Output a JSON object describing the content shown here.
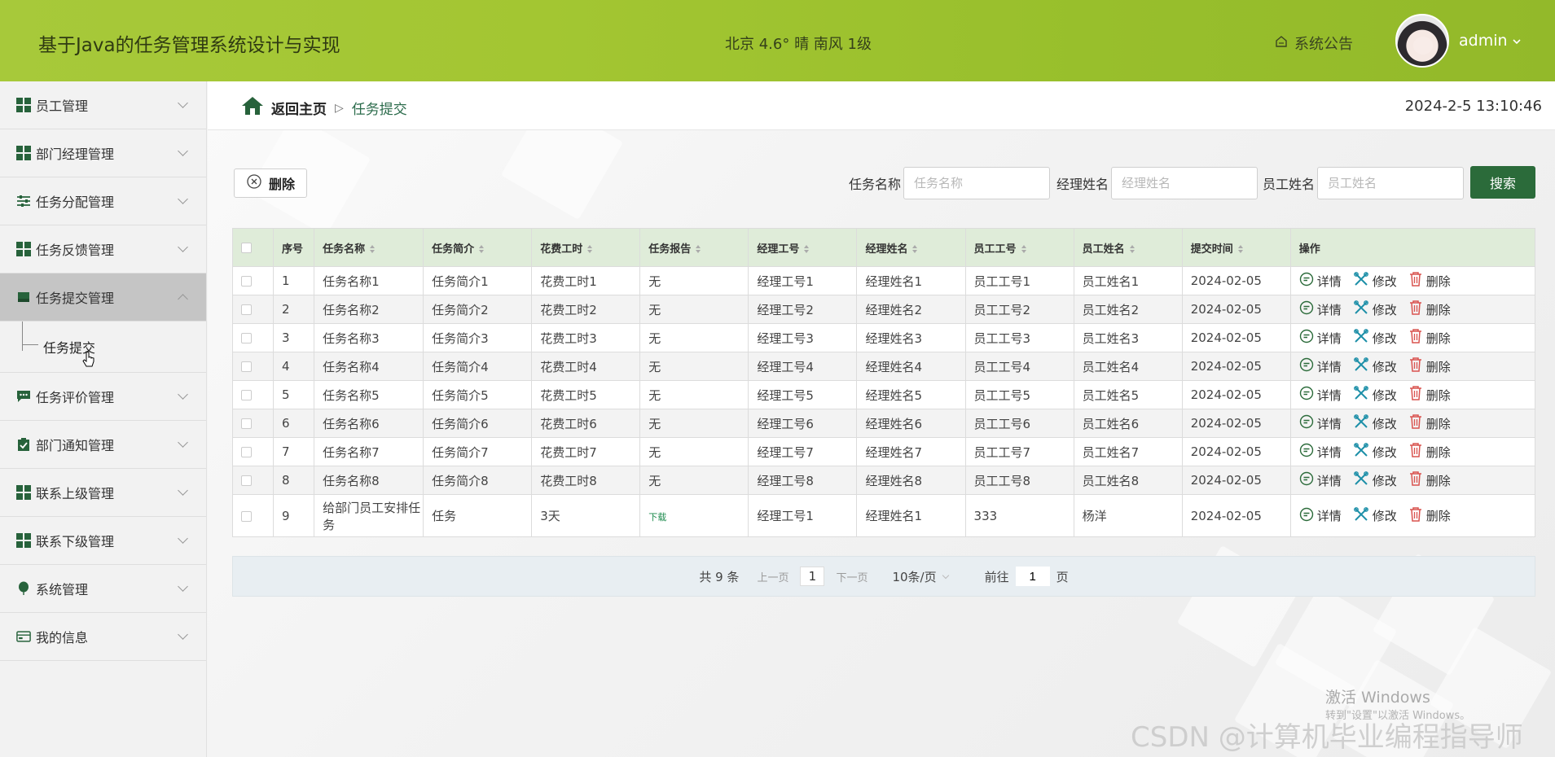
{
  "header": {
    "title": "基于Java的任务管理系统设计与实现",
    "weather": "北京 4.6° 晴 南风 1级",
    "notice": "系统公告",
    "username": "admin"
  },
  "sidebar": {
    "items": [
      {
        "label": "员工管理",
        "icon": "grid-icon"
      },
      {
        "label": "部门经理管理",
        "icon": "grid-icon"
      },
      {
        "label": "任务分配管理",
        "icon": "sliders-icon"
      },
      {
        "label": "任务反馈管理",
        "icon": "grid-icon"
      },
      {
        "label": "任务提交管理",
        "icon": "inbox-icon"
      },
      {
        "label": "任务评价管理",
        "icon": "comment-icon"
      },
      {
        "label": "部门通知管理",
        "icon": "clipboard-check-icon"
      },
      {
        "label": "联系上级管理",
        "icon": "grid-icon"
      },
      {
        "label": "联系下级管理",
        "icon": "grid-icon"
      },
      {
        "label": "系统管理",
        "icon": "balloon-icon"
      },
      {
        "label": "我的信息",
        "icon": "card-icon"
      }
    ],
    "submenu_label": "任务提交"
  },
  "breadcrumb": {
    "home": "返回主页",
    "current": "任务提交"
  },
  "datetime": "2024-2-5 13:10:46",
  "toolbar": {
    "delete_label": "删除",
    "search_label": "搜索"
  },
  "search": {
    "task_name_label": "任务名称",
    "task_name_placeholder": "任务名称",
    "manager_name_label": "经理姓名",
    "manager_name_placeholder": "经理姓名",
    "employee_name_label": "员工姓名",
    "employee_name_placeholder": "员工姓名"
  },
  "table": {
    "headers": [
      "序号",
      "任务名称",
      "任务简介",
      "花费工时",
      "任务报告",
      "经理工号",
      "经理姓名",
      "员工工号",
      "员工姓名",
      "提交时间",
      "操作"
    ],
    "ops": {
      "detail": "详情",
      "edit": "修改",
      "delete": "删除"
    },
    "rows": [
      [
        "1",
        "任务名称1",
        "任务简介1",
        "花费工时1",
        "无",
        "经理工号1",
        "经理姓名1",
        "员工工号1",
        "员工姓名1",
        "2024-02-05"
      ],
      [
        "2",
        "任务名称2",
        "任务简介2",
        "花费工时2",
        "无",
        "经理工号2",
        "经理姓名2",
        "员工工号2",
        "员工姓名2",
        "2024-02-05"
      ],
      [
        "3",
        "任务名称3",
        "任务简介3",
        "花费工时3",
        "无",
        "经理工号3",
        "经理姓名3",
        "员工工号3",
        "员工姓名3",
        "2024-02-05"
      ],
      [
        "4",
        "任务名称4",
        "任务简介4",
        "花费工时4",
        "无",
        "经理工号4",
        "经理姓名4",
        "员工工号4",
        "员工姓名4",
        "2024-02-05"
      ],
      [
        "5",
        "任务名称5",
        "任务简介5",
        "花费工时5",
        "无",
        "经理工号5",
        "经理姓名5",
        "员工工号5",
        "员工姓名5",
        "2024-02-05"
      ],
      [
        "6",
        "任务名称6",
        "任务简介6",
        "花费工时6",
        "无",
        "经理工号6",
        "经理姓名6",
        "员工工号6",
        "员工姓名6",
        "2024-02-05"
      ],
      [
        "7",
        "任务名称7",
        "任务简介7",
        "花费工时7",
        "无",
        "经理工号7",
        "经理姓名7",
        "员工工号7",
        "员工姓名7",
        "2024-02-05"
      ],
      [
        "8",
        "任务名称8",
        "任务简介8",
        "花费工时8",
        "无",
        "经理工号8",
        "经理姓名8",
        "员工工号8",
        "员工姓名8",
        "2024-02-05"
      ],
      [
        "9",
        "给部门员工安排任务",
        "任务",
        "3天",
        "下载",
        "经理工号1",
        "经理姓名1",
        "333",
        "杨洋",
        "2024-02-05"
      ]
    ]
  },
  "pager": {
    "total": "共 9 条",
    "prev": "上一页",
    "page": "1",
    "next": "下一页",
    "page_size": "10条/页",
    "goto_prefix": "前往",
    "goto_value": "1",
    "goto_suffix": "页"
  },
  "watermarks": {
    "windows_title": "激活 Windows",
    "windows_sub": "转到\"设置\"以激活 Windows。",
    "csdn": "CSDN @计算机毕业编程指导师"
  },
  "colors": {
    "header_green": "#a3c632",
    "accent_green": "#2b6b3a",
    "table_header": "#dfecd9"
  }
}
